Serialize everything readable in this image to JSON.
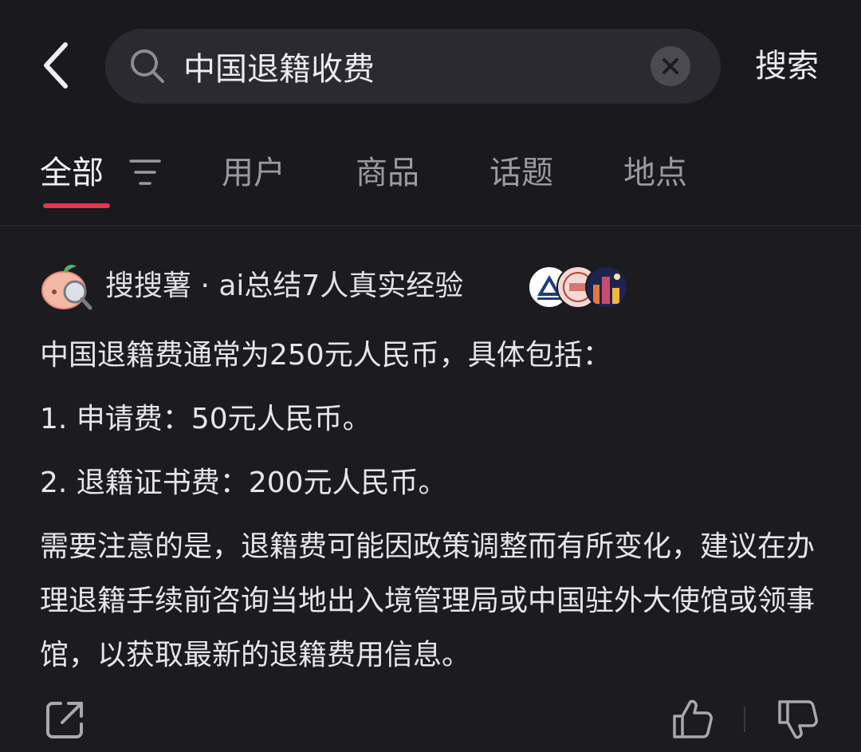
{
  "search": {
    "query": "中国退籍收费",
    "button_label": "搜索"
  },
  "tabs": [
    {
      "label": "全部",
      "active": true
    },
    {
      "label": "用户",
      "active": false
    },
    {
      "label": "商品",
      "active": false
    },
    {
      "label": "话题",
      "active": false
    },
    {
      "label": "地点",
      "active": false
    }
  ],
  "ai_summary": {
    "title": "搜搜薯 · ai总结7人真实经验",
    "avatar_icons": [
      "mountain-logo-avatar",
      "red-seal-avatar",
      "city-night-avatar"
    ],
    "lines": [
      "中国退籍费通常为250元人民币，具体包括：",
      "1. 申请费：50元人民币。",
      "2. 退籍证书费：200元人民币。"
    ],
    "note": "需要注意的是，退籍费可能因政策调整而有所变化，建议在办理退籍手续前咨询当地出入境管理局或中国驻外大使馆或领事馆，以获取最新的退籍费用信息。"
  },
  "colors": {
    "background": "#1c1b20",
    "search_box": "#2b2a30",
    "accent": "#e8334a",
    "text": "#e6e6e9",
    "inactive_tab": "#9b9aa0"
  },
  "icons": {
    "back": "chevron-left-icon",
    "search": "search-icon",
    "clear": "close-circle-icon",
    "filter": "filter-icon",
    "share": "share-icon",
    "like": "thumbs-up-icon",
    "dislike": "thumbs-down-icon"
  }
}
